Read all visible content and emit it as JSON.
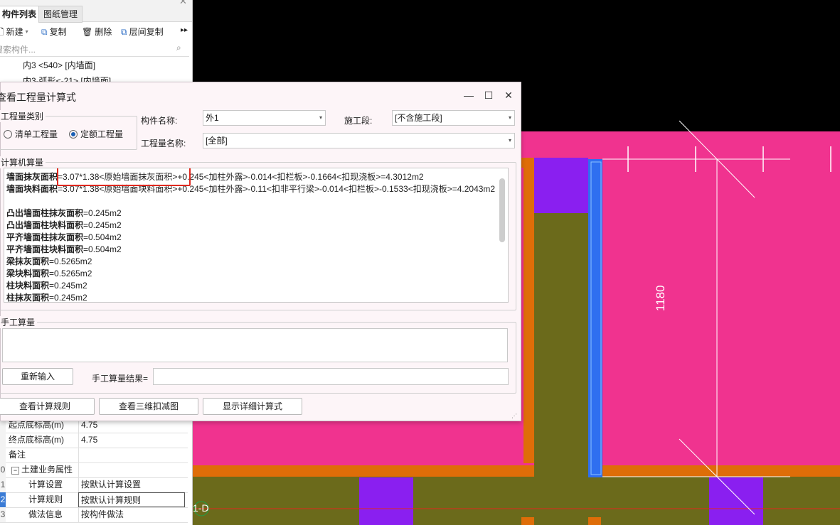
{
  "left_panel": {
    "tabs": [
      "构件列表",
      "图纸管理"
    ],
    "toolbar": {
      "new": "新建",
      "copy": "复制",
      "delete": "删除",
      "floor_copy": "层间复制"
    },
    "search_placeholder": "搜索构件...",
    "tree": [
      "内3 <540> [内墙面]",
      "内3-弧形<-21> [内墙面]"
    ],
    "properties": [
      {
        "num": "",
        "name": "起点底标高(m)",
        "value": "4.75"
      },
      {
        "num": "",
        "name": "终点底标高(m)",
        "value": "4.75"
      },
      {
        "num": "",
        "name": "备注",
        "value": ""
      },
      {
        "num": "0",
        "name": "土建业务属性",
        "value": ""
      },
      {
        "num": "1",
        "name": "计算设置",
        "value": "按默认计算设置"
      },
      {
        "num": "2",
        "name": "计算规则",
        "value": "按默认计算规则"
      },
      {
        "num": "3",
        "name": "做法信息",
        "value": "按构件做法"
      }
    ]
  },
  "dialog": {
    "title": "查看工程量计算式",
    "qty_category_label": "工程量类别",
    "radio_list": "清单工程量",
    "radio_quota": "定额工程量",
    "component_name_label": "构件名称:",
    "component_name_value": "外1",
    "construction_section_label": "施工段:",
    "construction_section_value": "[不含施工段]",
    "qty_name_label": "工程量名称:",
    "qty_name_value": "[全部]",
    "computer_calc_label": "计算机算量",
    "formulas": [
      {
        "name": "墙面抹灰面积",
        "expr": "=3.07*1.38<原始墙面抹灰面积>+0.245<加柱外露>-0.014<扣栏板>-0.1664<扣现浇板>=4.3012m2"
      },
      {
        "name": "墙面块料面积",
        "expr": "=3.07*1.38<原始墙面块料面积>+0.245<加柱外露>-0.11<扣非平行梁>-0.014<扣栏板>-0.1533<扣现浇板>=4.2043m2"
      },
      {
        "name": "凸出墙面柱抹灰面积",
        "expr": "=0.245m2"
      },
      {
        "name": "凸出墙面柱块料面积",
        "expr": "=0.245m2"
      },
      {
        "name": "平齐墙面柱抹灰面积",
        "expr": "=0.504m2"
      },
      {
        "name": "平齐墙面柱块料面积",
        "expr": "=0.504m2"
      },
      {
        "name": "梁抹灰面积",
        "expr": "=0.5265m2"
      },
      {
        "name": "梁块料面积",
        "expr": "=0.5265m2"
      },
      {
        "name": "柱块料面积",
        "expr": "=0.245m2"
      },
      {
        "name": "柱抹灰面积",
        "expr": "=0.245m2"
      }
    ],
    "manual_calc_label": "手工算量",
    "reinput_button": "重新输入",
    "manual_result_label": "手工算量结果=",
    "btn_rules": "查看计算规则",
    "btn_3d": "查看三维扣减图",
    "btn_detail": "显示详细计算式"
  },
  "canvas": {
    "dimension_label": "1180",
    "axis_label": "1-D"
  },
  "colors": {
    "pink": "#f0338f",
    "orange": "#df6d08",
    "olive": "#6b6a1b",
    "purple": "#8a1ff0",
    "blue": "#2f6ff0",
    "highlight_red": "#e0281e"
  }
}
